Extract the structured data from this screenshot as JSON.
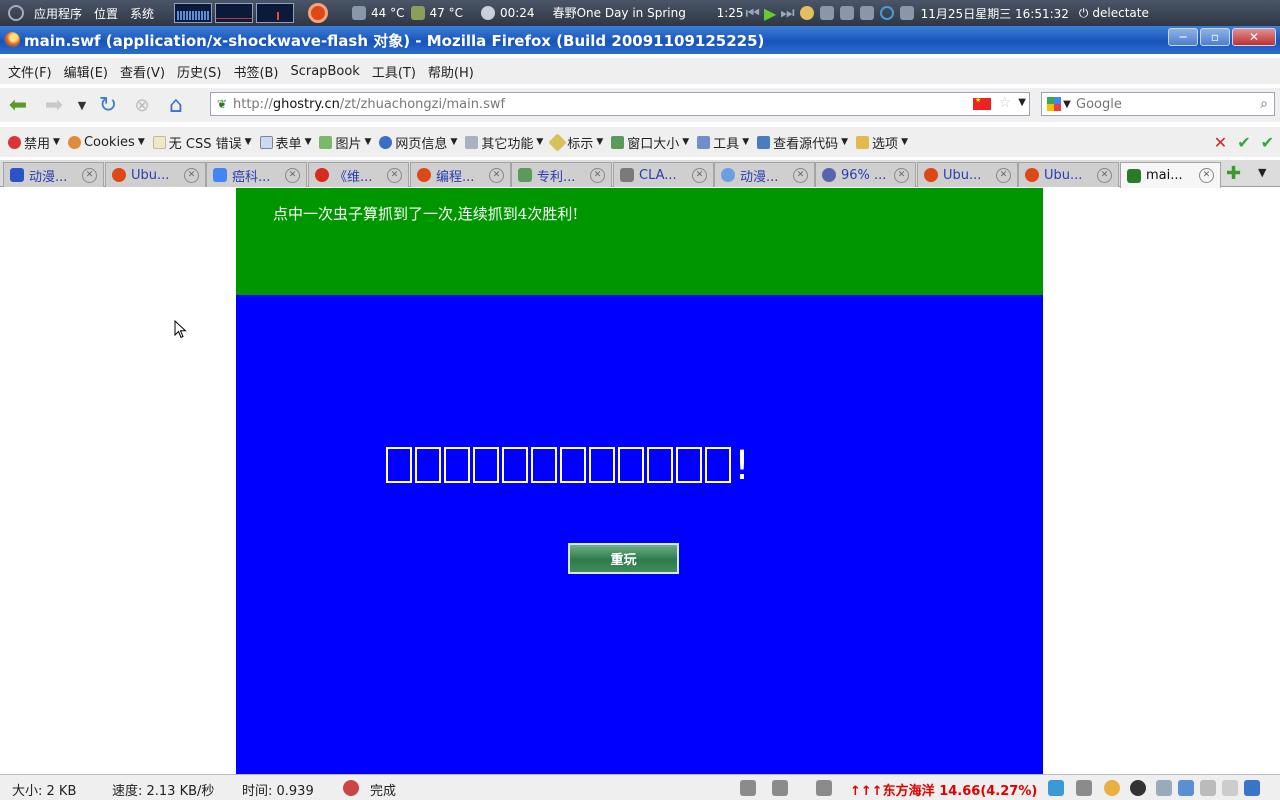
{
  "panel": {
    "menus": [
      "应用程序",
      "位置",
      "系统"
    ],
    "cpu_temp": "44 °C",
    "gpu_temp": "47 °C",
    "battery_time": "00:24",
    "song_title": "春野One Day in Spring",
    "track_time": "1:25",
    "datetime": "11月25日星期三 16:51:32",
    "user": "delectate"
  },
  "window": {
    "title": "main.swf (application/x-shockwave-flash 对象) - Mozilla Firefox (Build 20091109125225)",
    "controls": [
      "─",
      "▫",
      "✕"
    ]
  },
  "menubar": [
    "文件(F)",
    "编辑(E)",
    "查看(V)",
    "历史(S)",
    "书签(B)",
    "ScrapBook",
    "工具(T)",
    "帮助(H)"
  ],
  "navbar": {
    "url_prefix": "http://",
    "url_domain": "ghostry.cn",
    "url_path": "/zt/zhuachongzi/main.swf",
    "search_placeholder": "Google"
  },
  "devbar": [
    {
      "label": "禁用",
      "icon": "disable-icon"
    },
    {
      "label": "Cookies",
      "icon": "cookie-icon"
    },
    {
      "label": "无 CSS 错误",
      "icon": "css-icon"
    },
    {
      "label": "表单",
      "icon": "form-icon"
    },
    {
      "label": "图片",
      "icon": "image-icon"
    },
    {
      "label": "网页信息",
      "icon": "info-icon"
    },
    {
      "label": "其它功能",
      "icon": "misc-icon"
    },
    {
      "label": "标示",
      "icon": "outline-icon"
    },
    {
      "label": "窗口大小",
      "icon": "resize-icon"
    },
    {
      "label": "工具",
      "icon": "tools-icon"
    },
    {
      "label": "查看源代码",
      "icon": "view-source-icon"
    },
    {
      "label": "选项",
      "icon": "options-icon"
    }
  ],
  "tabs": [
    {
      "label": "动漫...",
      "color": "#2b53c9"
    },
    {
      "label": "Ubu...",
      "color": "#dd4814"
    },
    {
      "label": "癌科...",
      "color": "#4285f4"
    },
    {
      "label": "《维...",
      "color": "#d62c1f"
    },
    {
      "label": "编程...",
      "color": "#dd4814"
    },
    {
      "label": "专利...",
      "color": "#5a9a5a"
    },
    {
      "label": "CLA...",
      "color": "#7a7a7a"
    },
    {
      "label": "动漫...",
      "color": "#6aa0e0"
    },
    {
      "label": "96% ...",
      "color": "#5566aa"
    },
    {
      "label": "Ubu...",
      "color": "#dd4814"
    },
    {
      "label": "Ubu...",
      "color": "#dd4814"
    },
    {
      "label": "mai...",
      "color": "#2a7a2a"
    }
  ],
  "flash": {
    "instructions": "点中一次虫子算抓到了一次,连续抓到4次胜利!",
    "message_glyph_count": 12,
    "message_suffix": "!",
    "replay_label": "重玩"
  },
  "status": {
    "size": "大小: 2 KB",
    "speed": "速度: 2.13 KB/秒",
    "time": "时间: 0.939",
    "done": "完成",
    "stock": "↑↑↑东方海洋 14.66(4.27%)"
  }
}
